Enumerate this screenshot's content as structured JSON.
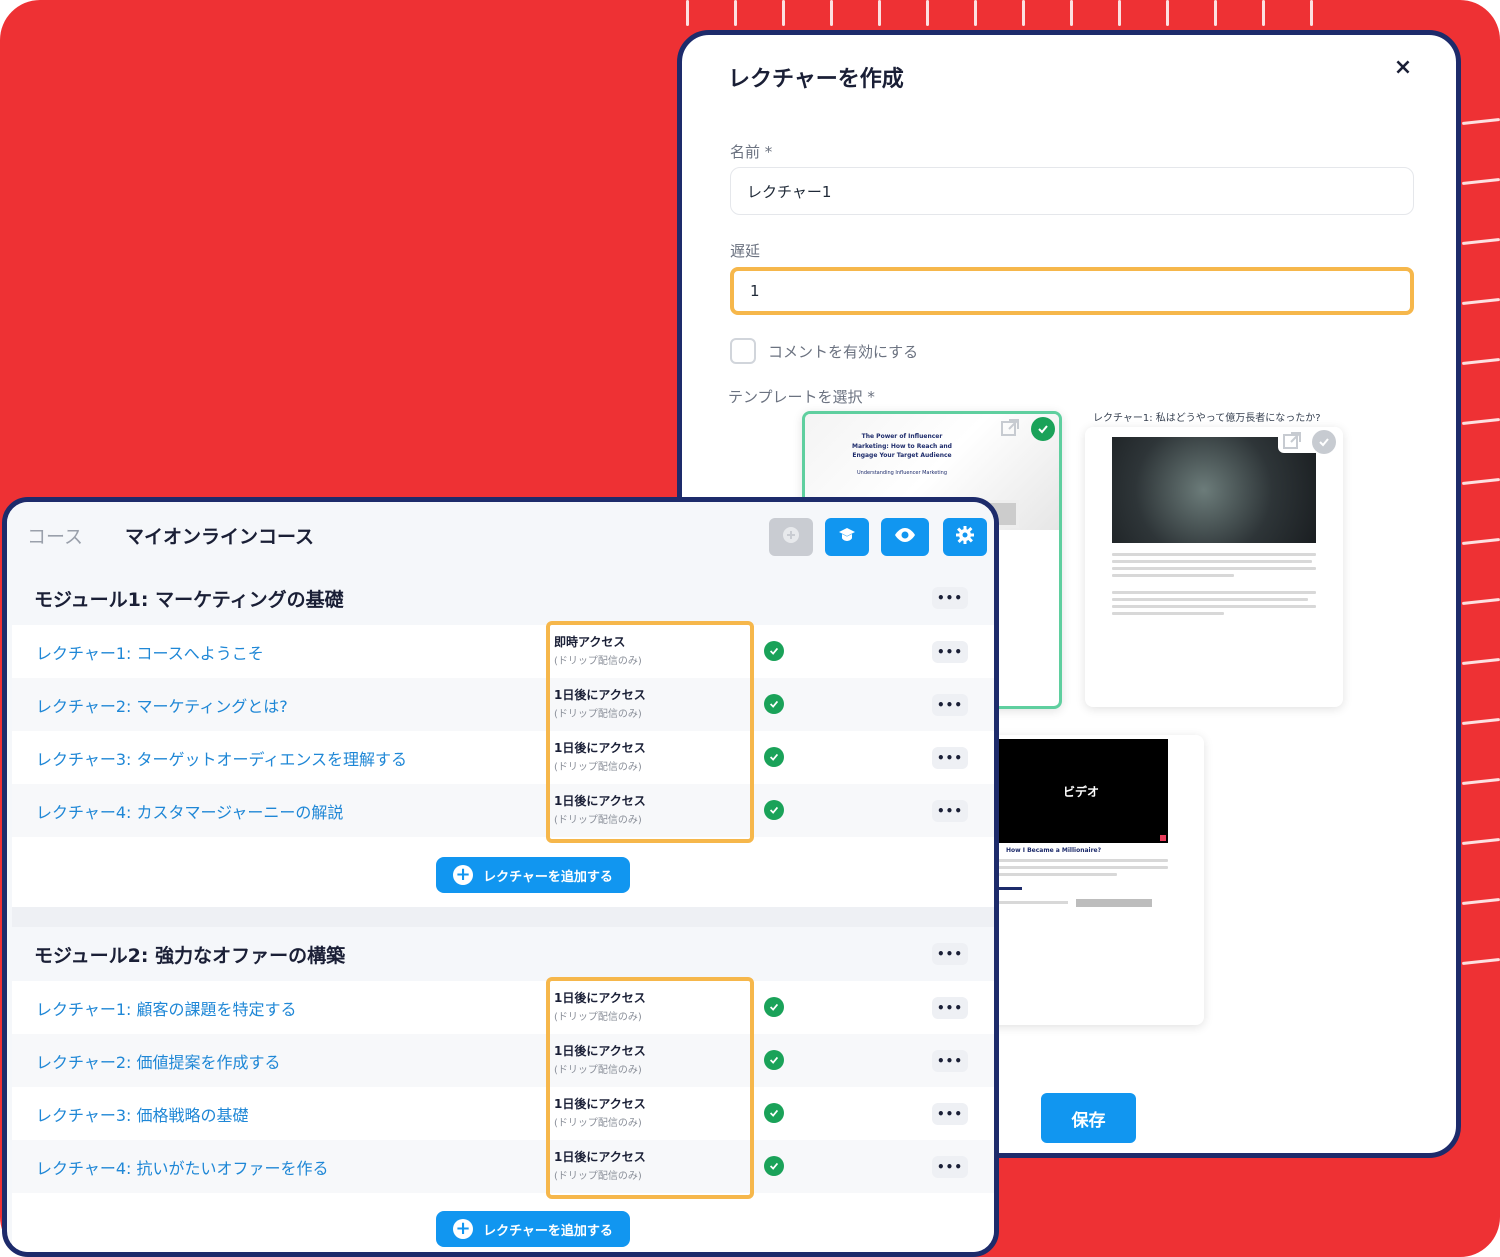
{
  "modal": {
    "title": "レクチャーを作成",
    "close_icon": "×",
    "name_label": "名前 *",
    "name_value": "レクチャー1",
    "delay_label": "遅延",
    "delay_value": "1",
    "comments_label": "コメントを有効にする",
    "template_label": "テンプレートを選択 *",
    "template2_caption": "レクチャー1: 私はどうやって億万長者になったか?",
    "template1_heading": "The Power of Influencer Marketing: How to Reach and Engage Your Target Audience",
    "template1_sub": "Understanding Influencer Marketing",
    "template3_video_label": "ビデオ",
    "template3_heading": "How I Became a Millionaire?",
    "save_label": "保存"
  },
  "course": {
    "crumb": "コース",
    "title": "マイオンラインコース",
    "add_lecture_label": "レクチャーを追加する",
    "modules": [
      {
        "title": "モジュール1: マーケティングの基礎",
        "lectures": [
          {
            "title": "レクチャー1: コースへようこそ",
            "access": "即時アクセス",
            "note": "(ドリップ配信のみ)"
          },
          {
            "title": "レクチャー2: マーケティングとは?",
            "access": "1日後にアクセス",
            "note": "(ドリップ配信のみ)"
          },
          {
            "title": "レクチャー3: ターゲットオーディエンスを理解する",
            "access": "1日後にアクセス",
            "note": "(ドリップ配信のみ)"
          },
          {
            "title": "レクチャー4: カスタマージャーニーの解説",
            "access": "1日後にアクセス",
            "note": "(ドリップ配信のみ)"
          }
        ]
      },
      {
        "title": "モジュール2: 強力なオファーの構築",
        "lectures": [
          {
            "title": "レクチャー1: 顧客の課題を特定する",
            "access": "1日後にアクセス",
            "note": "(ドリップ配信のみ)"
          },
          {
            "title": "レクチャー2: 価値提案を作成する",
            "access": "1日後にアクセス",
            "note": "(ドリップ配信のみ)"
          },
          {
            "title": "レクチャー3: 価格戦略の基礎",
            "access": "1日後にアクセス",
            "note": "(ドリップ配信のみ)"
          },
          {
            "title": "レクチャー4: 抗いがたいオファーを作る",
            "access": "1日後にアクセス",
            "note": "(ドリップ配信のみ)"
          }
        ]
      }
    ],
    "colors": {
      "accent": "#1196f0",
      "highlight": "#f6b74b",
      "success": "#1aa259",
      "frame": "#1d2b6b",
      "background": "#ee3134"
    }
  }
}
